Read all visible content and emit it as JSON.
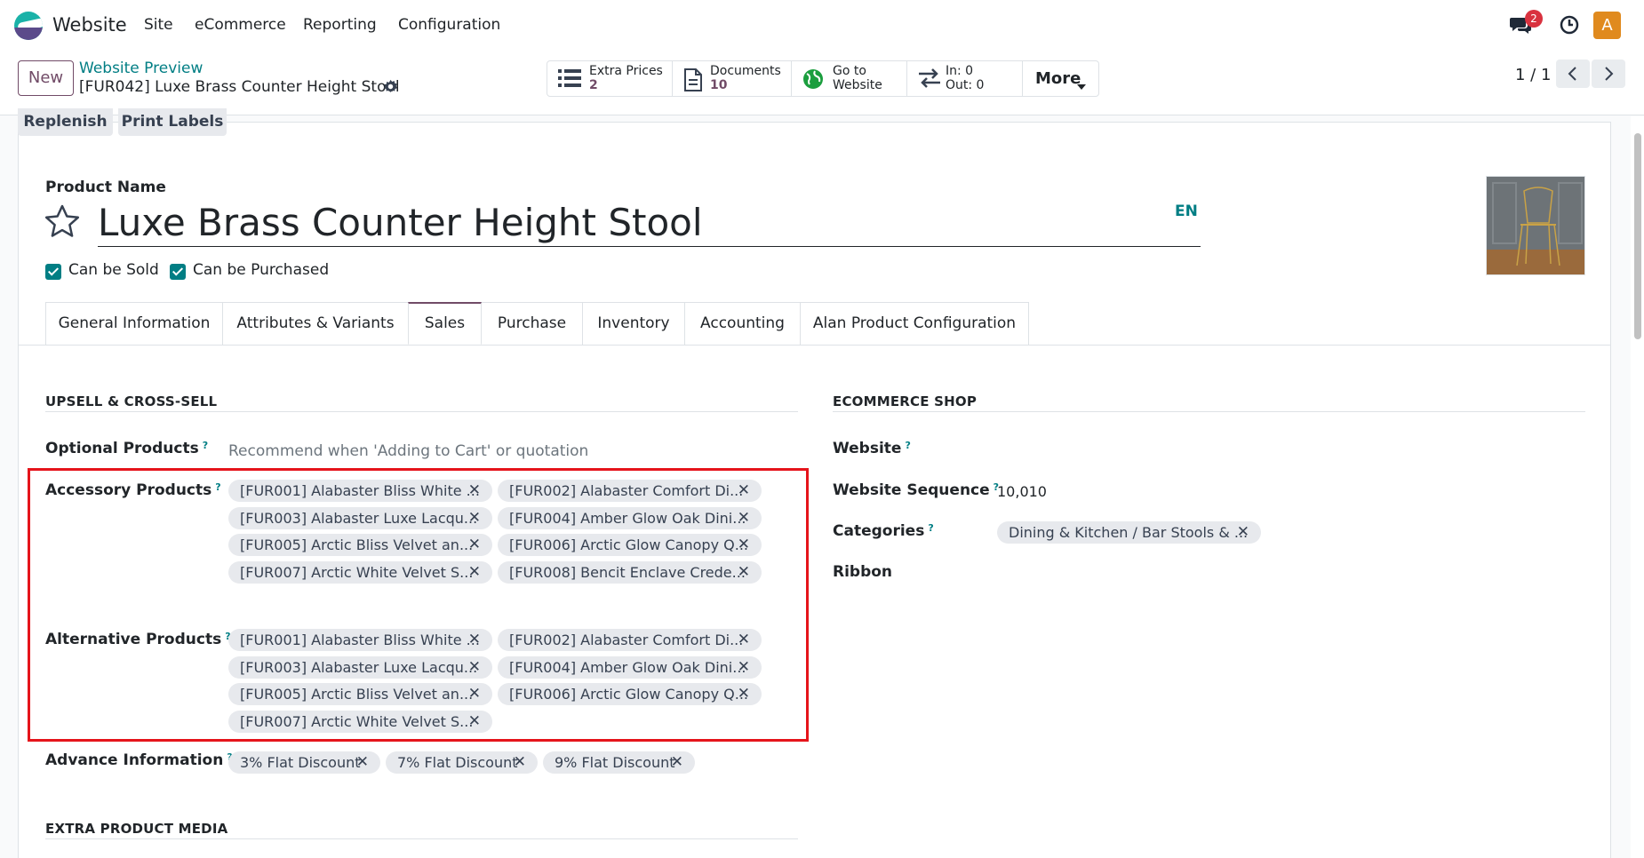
{
  "navbar": {
    "app_name": "Website",
    "menu": [
      "Site",
      "eCommerce",
      "Reporting",
      "Configuration"
    ],
    "messages_badge": "2",
    "avatar_letter": "A"
  },
  "control_panel": {
    "new_label": "New",
    "breadcrumb_parent": "Website Preview",
    "breadcrumb_current": "[FUR042] Luxe Brass Counter Height Stool",
    "stats": [
      {
        "label": "Extra Prices",
        "value": "2"
      },
      {
        "label": "Documents",
        "value": "10"
      },
      {
        "label": "Go to",
        "value": "Website"
      },
      {
        "label": "In: 0",
        "value": "Out: 0"
      }
    ],
    "more_label": "More",
    "pager": "1 / 1"
  },
  "actions": {
    "replenish": "Replenish",
    "print_labels": "Print Labels"
  },
  "product": {
    "name_label": "Product Name",
    "name": "Luxe Brass Counter Height Stool",
    "lang": "EN",
    "can_be_sold": "Can be Sold",
    "can_be_purchased": "Can be Purchased"
  },
  "tabs": [
    "General Information",
    "Attributes & Variants",
    "Sales",
    "Purchase",
    "Inventory",
    "Accounting",
    "Alan Product Configuration"
  ],
  "upsell": {
    "title": "UPSELL & CROSS-SELL",
    "optional_label": "Optional Products",
    "optional_placeholder": "Recommend when 'Adding to Cart' or quotation",
    "accessory_label": "Accessory Products",
    "accessory_tags": [
      "[FUR001] Alabaster Bliss White ...",
      "[FUR002] Alabaster Comfort Di...",
      "[FUR003] Alabaster Luxe Lacqu...",
      "[FUR004] Amber Glow Oak Dini...",
      "[FUR005] Arctic Bliss Velvet an...",
      "[FUR006] Arctic Glow Canopy Q...",
      "[FUR007] Arctic White Velvet S...",
      "[FUR008] Bencit Enclave Crede..."
    ],
    "alternative_label": "Alternative Products",
    "alternative_tags": [
      "[FUR001] Alabaster Bliss White ...",
      "[FUR002] Alabaster Comfort Di...",
      "[FUR003] Alabaster Luxe Lacqu...",
      "[FUR004] Amber Glow Oak Dini...",
      "[FUR005] Arctic Bliss Velvet an...",
      "[FUR006] Arctic Glow Canopy Q...",
      "[FUR007] Arctic White Velvet S..."
    ],
    "advance_label": "Advance Information",
    "advance_tags": [
      "3% Flat Discount",
      "7% Flat Discount",
      "9% Flat Discount"
    ]
  },
  "ecommerce": {
    "title": "ECOMMERCE SHOP",
    "website_label": "Website",
    "sequence_label": "Website Sequence",
    "sequence_value": "10,010",
    "categories_label": "Categories",
    "category_tag": "Dining & Kitchen / Bar Stools & ...",
    "ribbon_label": "Ribbon"
  },
  "extra_media": {
    "title": "EXTRA PRODUCT MEDIA"
  },
  "colors": {
    "brand": "#714b67",
    "teal": "#017e84",
    "highlight": "#e5141b"
  }
}
